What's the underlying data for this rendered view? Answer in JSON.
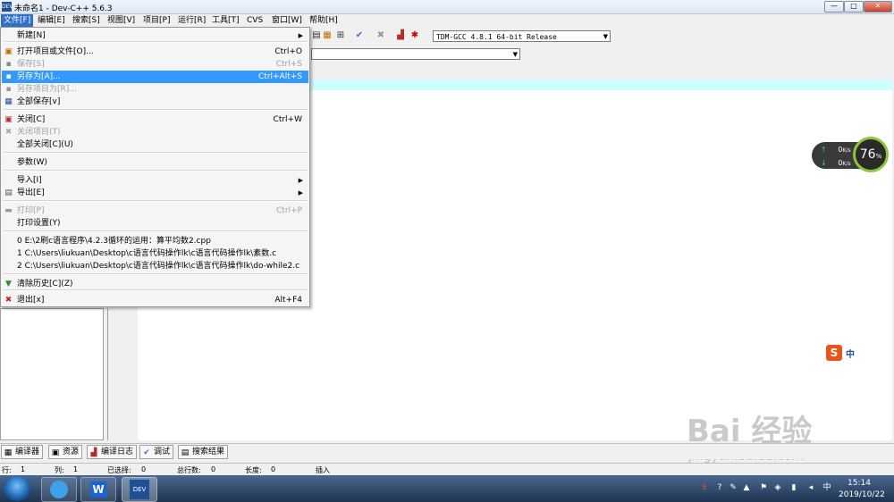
{
  "window": {
    "title": "未命名1 - Dev-C++ 5.6.3",
    "min": "—",
    "max": "□",
    "close": "✕"
  },
  "menubar": [
    "文件[F]",
    "编辑[E]",
    "搜索[S]",
    "视图[V]",
    "项目[P]",
    "运行[R]",
    "工具[T]",
    "CVS",
    "窗口[W]",
    "帮助[H]"
  ],
  "toolbar": {
    "compiler": "TDM-GCC 4.8.1 64-bit Release",
    "combo2": ""
  },
  "file_menu": [
    {
      "label": "新建[N]",
      "shortcut": "",
      "submenu": true,
      "disabled": false,
      "icon": ""
    },
    {
      "sep": true
    },
    {
      "label": "打开项目或文件[O]...",
      "shortcut": "Ctrl+O",
      "disabled": false,
      "icon": "open-icon"
    },
    {
      "label": "保存[S]",
      "shortcut": "Ctrl+S",
      "disabled": true,
      "icon": "save-icon"
    },
    {
      "label": "另存为[A]...",
      "shortcut": "Ctrl+Alt+S",
      "disabled": false,
      "highlight": true,
      "icon": "save-as-icon"
    },
    {
      "label": "另存项目为[R]...",
      "shortcut": "",
      "disabled": true,
      "icon": "save-project-icon"
    },
    {
      "label": "全部保存[v]",
      "shortcut": "",
      "disabled": false,
      "icon": "save-all-icon"
    },
    {
      "sep": true
    },
    {
      "label": "关闭[C]",
      "shortcut": "Ctrl+W",
      "disabled": false,
      "icon": "close-file-icon"
    },
    {
      "label": "关闭项目(T)",
      "shortcut": "",
      "disabled": true,
      "icon": "close-project-icon"
    },
    {
      "label": "全部关闭[C](U)",
      "shortcut": "",
      "disabled": false,
      "icon": ""
    },
    {
      "sep": true
    },
    {
      "label": "参数(W)",
      "shortcut": "",
      "disabled": false,
      "icon": ""
    },
    {
      "sep": true
    },
    {
      "label": "导入[I]",
      "shortcut": "",
      "submenu": true,
      "disabled": false,
      "icon": ""
    },
    {
      "label": "导出[E]",
      "shortcut": "",
      "submenu": true,
      "disabled": false,
      "icon": "export-icon"
    },
    {
      "sep": true
    },
    {
      "label": "打印[P]",
      "shortcut": "Ctrl+P",
      "disabled": true,
      "icon": "print-icon"
    },
    {
      "label": "打印设置(Y)",
      "shortcut": "",
      "disabled": false,
      "icon": ""
    },
    {
      "sep": true
    },
    {
      "label": "0 E:\\2刷c语言程序\\4.2.3循环的运用：算平均数2.cpp",
      "shortcut": "",
      "disabled": false,
      "icon": ""
    },
    {
      "label": "1 C:\\Users\\liukuan\\Desktop\\c语言代码操作lk\\c语言代码操作lk\\素数.c",
      "shortcut": "",
      "disabled": false,
      "icon": ""
    },
    {
      "label": "2 C:\\Users\\liukuan\\Desktop\\c语言代码操作lk\\c语言代码操作lk\\do-while2.c",
      "shortcut": "",
      "disabled": false,
      "icon": ""
    },
    {
      "sep": true
    },
    {
      "label": "清除历史[C](Z)",
      "shortcut": "",
      "disabled": false,
      "icon": "clear-history-icon"
    },
    {
      "sep": true
    },
    {
      "label": "退出[x]",
      "shortcut": "Alt+F4",
      "disabled": false,
      "icon": "exit-icon"
    }
  ],
  "bottom_tabs": [
    "编译器",
    "资源",
    "编译日志",
    "调试",
    "搜索结果"
  ],
  "status": {
    "row_label": "行:",
    "row": "1",
    "col_label": "列:",
    "col": "1",
    "sel_label": "已选择:",
    "sel": "0",
    "lines_label": "总行数:",
    "lines": "0",
    "len_label": "长度:",
    "len": "0",
    "mode": "插入"
  },
  "net": {
    "up": "0",
    "down": "0",
    "unit": "K/s",
    "percent": "76",
    "percent_sign": "%"
  },
  "ime": {
    "label": "中"
  },
  "taskbar": {
    "time": "15:14",
    "date": "2019/10/22"
  },
  "watermark": {
    "text": "Bai 经验",
    "sub": "jingyan.baidu.com"
  }
}
